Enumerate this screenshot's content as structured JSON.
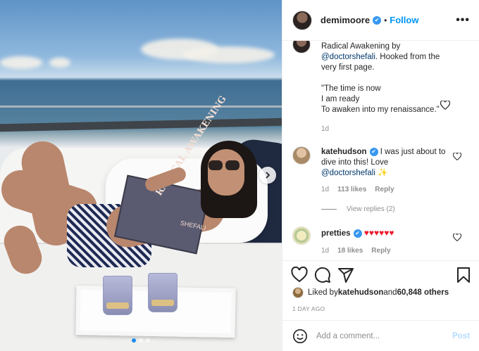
{
  "colors": {
    "accent": "#0095f6",
    "verified": "#3897f0",
    "heart": "#ed1b2e",
    "muted": "#8e8e8e"
  },
  "photo": {
    "book_title": "RADICAL AWAKENING",
    "book_author": "SHEFALI",
    "carousel_count": 3,
    "carousel_active": 0
  },
  "header": {
    "username": "demimoore",
    "separator": "•",
    "follow": "Follow",
    "more": "•••"
  },
  "caption": {
    "line1": "Radical Awakening by",
    "mention": "@doctorshefali",
    "line2": ". Hooked from the very first page.",
    "quote1": "\"The time is now",
    "quote2": "I am ready",
    "quote3": "To awaken into my renaissance.\"",
    "time": "1d"
  },
  "comments": [
    {
      "username": "katehudson",
      "text_before": " I was just about to dive into this! Love",
      "mention": "@doctorshefali",
      "emoji": "✨",
      "time": "1d",
      "likes": "113 likes",
      "reply": "Reply",
      "view_replies": "View replies (2)"
    },
    {
      "username": "pretties",
      "hearts": "♥♥♥♥♥♥",
      "time": "1d",
      "likes": "18 likes",
      "reply": "Reply"
    }
  ],
  "actions": {
    "icons": [
      "heart-icon",
      "comment-icon",
      "share-icon",
      "bookmark-icon"
    ]
  },
  "likes": {
    "prefix": "Liked by ",
    "user": "katehudson",
    "middle": " and ",
    "count": "60,848 others"
  },
  "timeago": "1 DAY AGO",
  "add_comment": {
    "placeholder": "Add a comment...",
    "post": "Post"
  }
}
